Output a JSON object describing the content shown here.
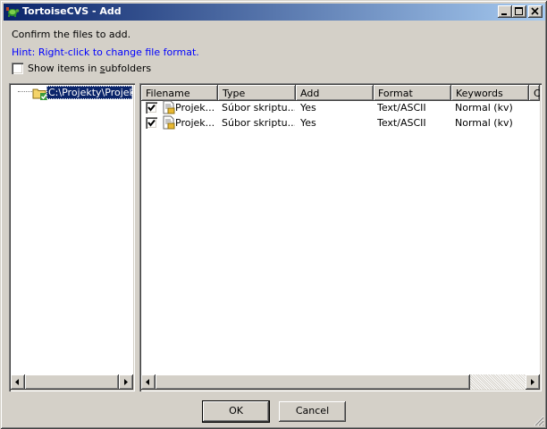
{
  "window": {
    "title": "TortoiseCVS - Add",
    "icon": "tortoise-icon"
  },
  "intro": {
    "confirm_text": "Confirm the files to add.",
    "hint_text": "Hint: Right-click to change file format.",
    "hint_color": "#0000ff",
    "show_subfolders_prefix": "Show items in ",
    "show_subfolders_mnemonic": "s",
    "show_subfolders_suffix": "ubfolders",
    "show_subfolders_checked": false
  },
  "tree": {
    "items": [
      {
        "label": "C:\\Projekty\\Projekt",
        "icon": "folder-check-icon",
        "selected": true
      }
    ]
  },
  "file_list": {
    "columns": [
      "Filename",
      "Type",
      "Add",
      "Format",
      "Keywords",
      "C"
    ],
    "rows": [
      {
        "checked": true,
        "icon": "script-file-icon",
        "filename": "Projek...",
        "type": "Súbor skriptu...",
        "add": "Yes",
        "format": "Text/ASCII",
        "keywords": "Normal (kv)"
      },
      {
        "checked": true,
        "icon": "script-file-icon",
        "filename": "Projek...",
        "type": "Súbor skriptu...",
        "add": "Yes",
        "format": "Text/ASCII",
        "keywords": "Normal (kv)"
      }
    ]
  },
  "buttons": {
    "ok": "OK",
    "cancel": "Cancel"
  },
  "colors": {
    "titlebar_start": "#0a246a",
    "titlebar_end": "#a6caf0",
    "selection": "#0a246a",
    "face": "#d4d0c8"
  }
}
